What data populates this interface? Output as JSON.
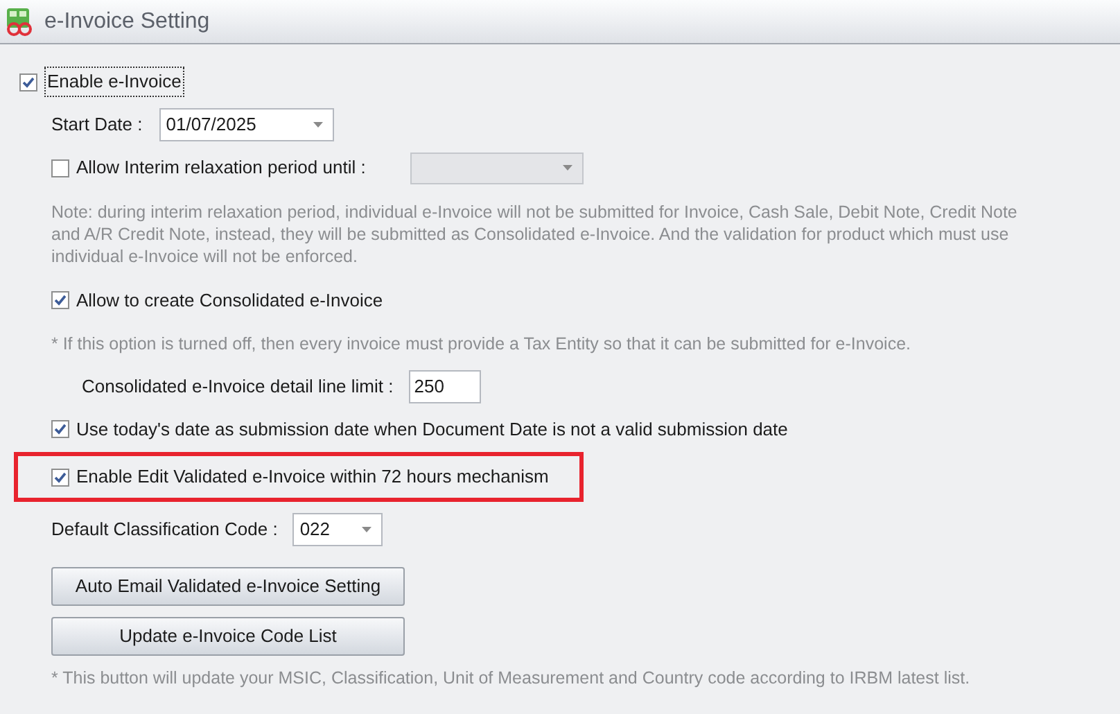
{
  "window": {
    "title": "e-Invoice Setting"
  },
  "enable": {
    "label": "Enable e-Invoice",
    "checked": true,
    "focused": true
  },
  "rows": [
    {
      "kind": "date_field",
      "label": "Start Date :",
      "value": "01/07/2025"
    },
    {
      "kind": "checkbox_dropdown",
      "label": "Allow Interim relaxation period until :",
      "checked": false,
      "disabled": true
    },
    {
      "kind": "note",
      "text": "Note: during interim relaxation period, individual e-Invoice will not be submitted for Invoice, Cash Sale, Debit Note, Credit Note and A/R Credit Note, instead, they will be submitted as Consolidated e-Invoice. And the validation for product which must use individual e-Invoice will not be enforced."
    },
    {
      "kind": "checkbox",
      "label": "Allow to create Consolidated e-Invoice",
      "checked": true,
      "highlighted": false
    },
    {
      "kind": "note",
      "text": "* If this option is turned off, then every invoice must provide a Tax Entity so that it can be submitted for e-Invoice."
    },
    {
      "kind": "number_field",
      "label": "Consolidated e-Invoice detail line limit :",
      "value": "250"
    },
    {
      "kind": "checkbox",
      "label": "Use today's date as submission date when Document Date is not a valid submission date",
      "checked": true,
      "highlighted": false
    },
    {
      "kind": "checkbox",
      "label": "Enable Edit Validated e-Invoice within 72 hours mechanism",
      "checked": true,
      "highlighted": true
    },
    {
      "kind": "dropdown",
      "label": "Default Classification Code :",
      "value": "022"
    },
    {
      "kind": "button",
      "label": "Auto Email Validated e-Invoice Setting"
    },
    {
      "kind": "button",
      "label": "Update e-Invoice Code List"
    },
    {
      "kind": "note",
      "text": "* This button will update your MSIC, Classification, Unit of Measurement and Country code according to IRBM latest list."
    }
  ]
}
